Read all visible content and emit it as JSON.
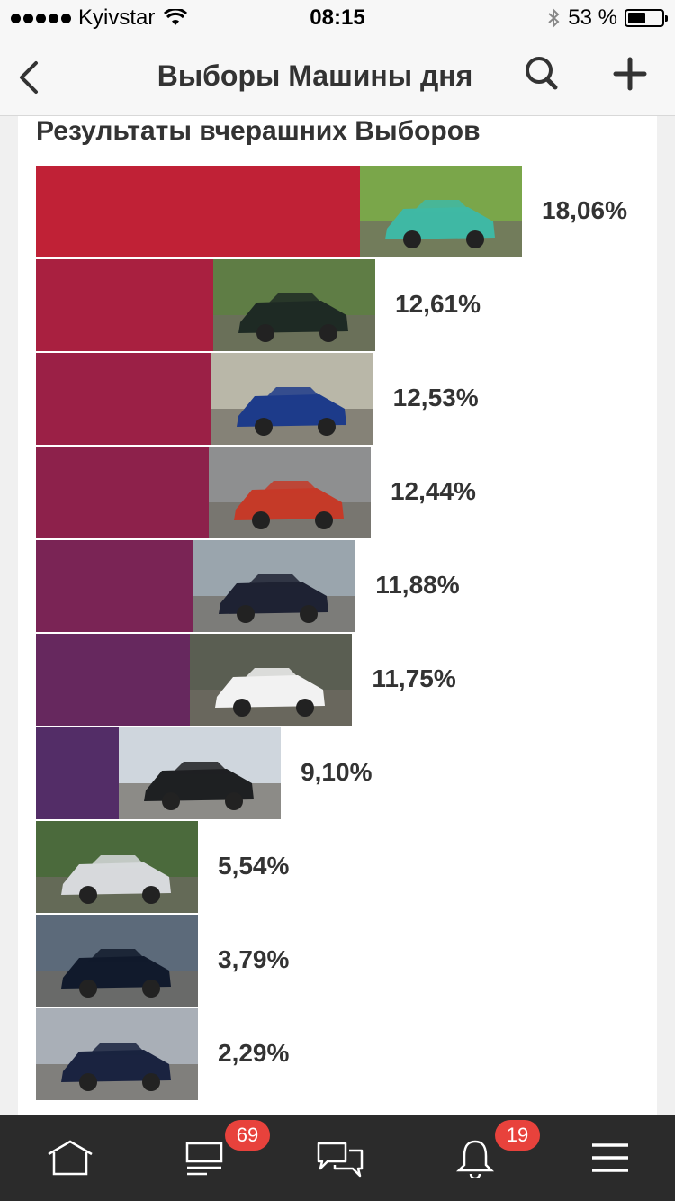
{
  "status_bar": {
    "carrier": "Kyivstar",
    "time": "08:15",
    "battery": "53 %",
    "battery_level": 0.53
  },
  "nav": {
    "title": "Выборы Машины дня",
    "back_icon": "chevron-left-icon",
    "search_icon": "search-icon",
    "add_icon": "plus-icon"
  },
  "results": {
    "title": "Результаты вчерашних Выборов",
    "items": [
      {
        "percent": "18,06%",
        "value": 18.06,
        "color": "#c02136"
      },
      {
        "percent": "12,61%",
        "value": 12.61,
        "color": "#a92040"
      },
      {
        "percent": "12,53%",
        "value": 12.53,
        "color": "#9b2046"
      },
      {
        "percent": "12,44%",
        "value": 12.44,
        "color": "#8d214b"
      },
      {
        "percent": "11,88%",
        "value": 11.88,
        "color": "#7a2455"
      },
      {
        "percent": "11,75%",
        "value": 11.75,
        "color": "#66285e"
      },
      {
        "percent": "9,10%",
        "value": 9.1,
        "color": "#532d67"
      },
      {
        "percent": "5,54%",
        "value": 5.54,
        "color": "#41336e"
      },
      {
        "percent": "3,79%",
        "value": 3.79,
        "color": "#333b7c"
      },
      {
        "percent": "2,29%",
        "value": 2.29,
        "color": "#2d4d8c"
      }
    ]
  },
  "tabbar": {
    "home_icon": "home-icon",
    "feed_icon": "feed-icon",
    "feed_badge": "69",
    "messages_icon": "messages-icon",
    "notifications_icon": "bell-icon",
    "notifications_badge": "19",
    "menu_icon": "menu-icon"
  }
}
